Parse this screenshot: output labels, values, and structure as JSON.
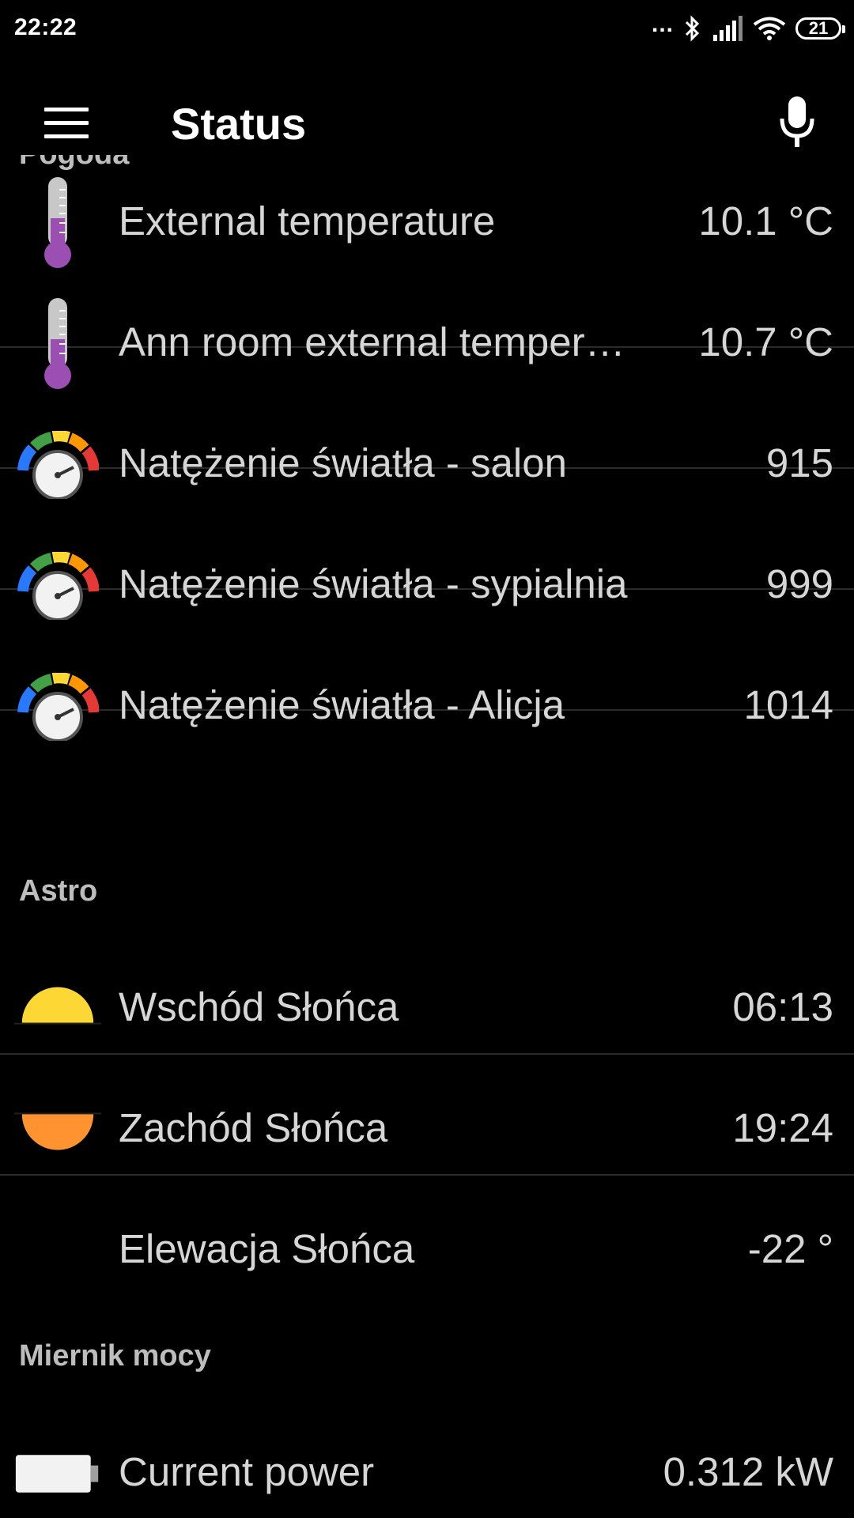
{
  "status_bar": {
    "time": "22:22",
    "dots": "...",
    "battery": "21"
  },
  "app_bar": {
    "title": "Status",
    "menu_icon": "hamburger-menu-icon",
    "mic_icon": "microphone-icon"
  },
  "sections": {
    "pogoda": {
      "header": "Pogoda",
      "items": [
        {
          "icon": "thermometer-icon",
          "label": "External temperature",
          "value": "10.1 °C"
        },
        {
          "icon": "thermometer-icon",
          "label": "Ann room external temper…",
          "value": "10.7 °C"
        },
        {
          "icon": "light-meter-icon",
          "label": "Natężenie światła - salon",
          "value": "915"
        },
        {
          "icon": "light-meter-icon",
          "label": "Natężenie światła - sypialnia",
          "value": "999"
        },
        {
          "icon": "light-meter-icon",
          "label": "Natężenie światła - Alicja",
          "value": "1014"
        }
      ]
    },
    "astro": {
      "header": "Astro",
      "items": [
        {
          "icon": "sunrise-icon",
          "label": "Wschód Słońca",
          "value": "06:13"
        },
        {
          "icon": "sunset-icon",
          "label": "Zachód Słońca",
          "value": "19:24"
        },
        {
          "icon": "",
          "label": "Elewacja Słońca",
          "value": "-22 °"
        }
      ]
    },
    "miernik": {
      "header": "Miernik mocy",
      "items": [
        {
          "icon": "battery-power-icon",
          "label": "Current power",
          "value": "0.312 kW"
        }
      ]
    }
  },
  "colors": {
    "background": "#000000",
    "text": "#d6d6d6",
    "section_header": "#bdbdbd",
    "thermometer_fill": "#9b4fb3",
    "sunrise": "#fdd835",
    "sunset": "#ff9330"
  }
}
